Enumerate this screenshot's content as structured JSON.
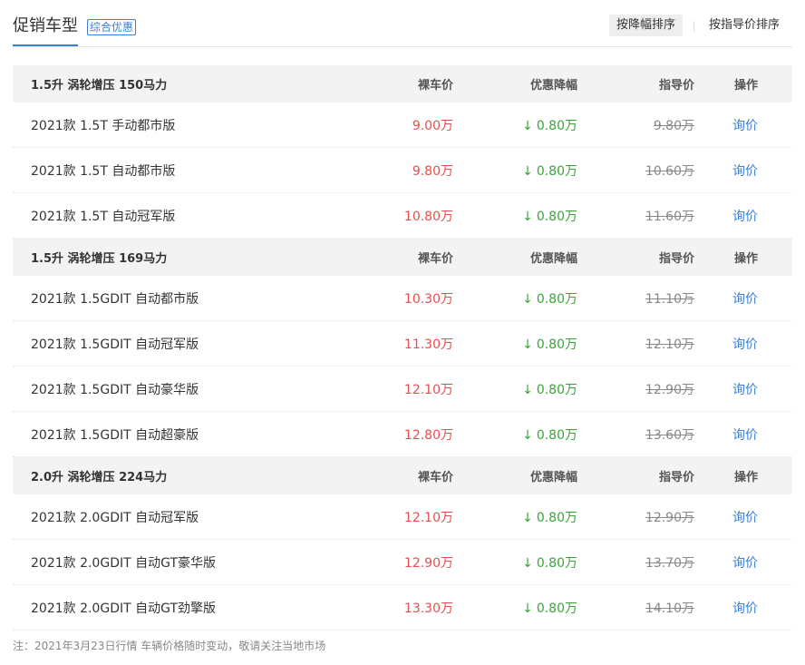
{
  "header": {
    "title": "促销车型",
    "tag": "综合优惠",
    "sort_options": [
      "按降幅排序",
      "按指导价排序"
    ]
  },
  "columns": {
    "price": "裸车价",
    "discount": "优惠降幅",
    "guide": "指导价",
    "op": "操作"
  },
  "groups": [
    {
      "title": "1.5升 涡轮增压 150马力",
      "rows": [
        {
          "name": "2021款 1.5T 手动都市版",
          "price": "9.00万",
          "discount": "0.80万",
          "guide": "9.80万",
          "op": "询价"
        },
        {
          "name": "2021款 1.5T 自动都市版",
          "price": "9.80万",
          "discount": "0.80万",
          "guide": "10.60万",
          "op": "询价"
        },
        {
          "name": "2021款 1.5T 自动冠军版",
          "price": "10.80万",
          "discount": "0.80万",
          "guide": "11.60万",
          "op": "询价"
        }
      ]
    },
    {
      "title": "1.5升 涡轮增压 169马力",
      "rows": [
        {
          "name": "2021款 1.5GDIT 自动都市版",
          "price": "10.30万",
          "discount": "0.80万",
          "guide": "11.10万",
          "op": "询价"
        },
        {
          "name": "2021款 1.5GDIT 自动冠军版",
          "price": "11.30万",
          "discount": "0.80万",
          "guide": "12.10万",
          "op": "询价"
        },
        {
          "name": "2021款 1.5GDIT 自动豪华版",
          "price": "12.10万",
          "discount": "0.80万",
          "guide": "12.90万",
          "op": "询价"
        },
        {
          "name": "2021款 1.5GDIT 自动超豪版",
          "price": "12.80万",
          "discount": "0.80万",
          "guide": "13.60万",
          "op": "询价"
        }
      ]
    },
    {
      "title": "2.0升 涡轮增压 224马力",
      "rows": [
        {
          "name": "2021款 2.0GDIT 自动冠军版",
          "price": "12.10万",
          "discount": "0.80万",
          "guide": "12.90万",
          "op": "询价"
        },
        {
          "name": "2021款 2.0GDIT 自动GT豪华版",
          "price": "12.90万",
          "discount": "0.80万",
          "guide": "13.70万",
          "op": "询价"
        },
        {
          "name": "2021款 2.0GDIT 自动GT劲擎版",
          "price": "13.30万",
          "discount": "0.80万",
          "guide": "14.10万",
          "op": "询价"
        }
      ]
    }
  ],
  "note": "注：2021年3月23日行情 车辆价格随时变动，敬请关注当地市场",
  "colors": {
    "accent": "#3d7fd1",
    "price": "#e84e4e",
    "discount": "#3aa53a",
    "guide": "#888888"
  }
}
